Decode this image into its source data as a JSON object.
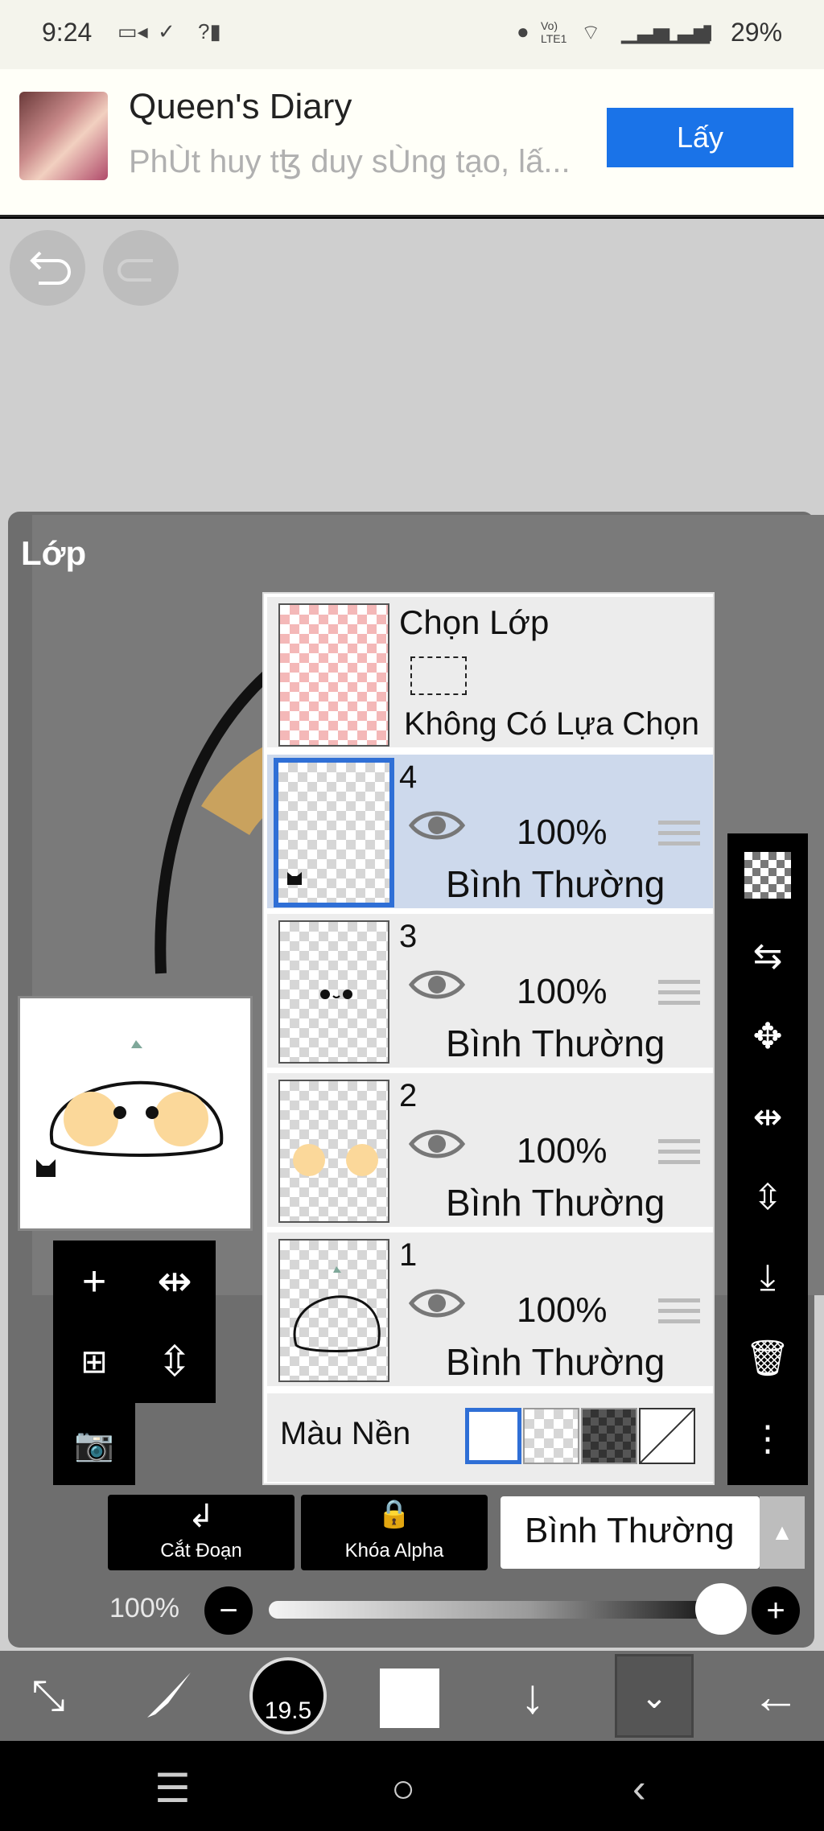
{
  "status_bar": {
    "time": "9:24",
    "battery_text": "29%",
    "icons": [
      "video-icon",
      "check-icon",
      "signal-question-icon",
      "dot-icon",
      "volte-icon",
      "wifi-icon",
      "signal-icon",
      "signal-icon-2",
      "battery-icon"
    ],
    "network_label": "Vo) LTE1"
  },
  "ad": {
    "title": "Queen's Diary",
    "subtitle": "PhÙt huy tꜩ duy sÙng tạo, lấ...",
    "button": "Lấy",
    "button_color": "#1a73e8"
  },
  "panel": {
    "title": "Lớp"
  },
  "layers": {
    "selection_layer": {
      "title": "Chọn Lớp",
      "status": "Không Có Lựa Chọn"
    },
    "items": [
      {
        "number": "4",
        "opacity": "100%",
        "mode": "Bình Thường",
        "selected": true
      },
      {
        "number": "3",
        "opacity": "100%",
        "mode": "Bình Thường",
        "selected": false
      },
      {
        "number": "2",
        "opacity": "100%",
        "mode": "Bình Thường",
        "selected": false
      },
      {
        "number": "1",
        "opacity": "100%",
        "mode": "Bình Thường",
        "selected": false
      }
    ],
    "background_label": "Màu Nền"
  },
  "right_toolbar": [
    "checker-icon",
    "swap-layers-icon",
    "move-icon",
    "flip-horizontal-icon",
    "flip-vertical-icon",
    "merge-down-icon",
    "trash-icon",
    "more-icon"
  ],
  "controls": {
    "cut_label": "Cắt Đoạn",
    "alpha_lock_label": "Khóa Alpha",
    "blend_mode": "Bình Thường",
    "opacity_label": "100%",
    "opacity_value": 1.0
  },
  "bottom_bar": {
    "brush_size": "19.5",
    "icons": [
      "transform-tool-icon",
      "brush-icon",
      "brush-size-icon",
      "color-swatch-icon",
      "down-arrow-icon",
      "collapse-icon",
      "back-arrow-icon"
    ]
  },
  "accent": "#2f6fd6"
}
